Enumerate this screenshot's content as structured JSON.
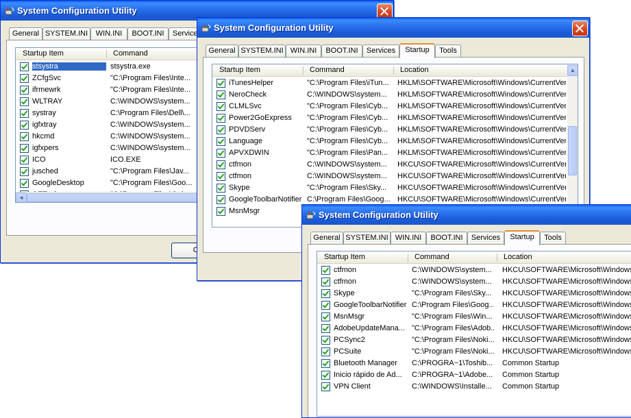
{
  "app_title": "System Configuration Utility",
  "accent": "#e68b2c",
  "tabs": [
    "General",
    "SYSTEM.INI",
    "WIN.INI",
    "BOOT.INI",
    "Services",
    "Startup",
    "Tools"
  ],
  "columns": {
    "item": "Startup Item",
    "command": "Command",
    "location": "Location"
  },
  "win1": {
    "rows": [
      {
        "name": "stsystra",
        "command": "stsystra.exe",
        "selected": true
      },
      {
        "name": "ZCfgSvc",
        "command": "\"C:\\Program Files\\Inte..."
      },
      {
        "name": "ifrmewrk",
        "command": "\"C:\\Program Files\\Inte..."
      },
      {
        "name": "WLTRAY",
        "command": "C:\\WINDOWS\\system..."
      },
      {
        "name": "systray",
        "command": "C:\\Program Files\\Dell\\..."
      },
      {
        "name": "igfxtray",
        "command": "C:\\WINDOWS\\system..."
      },
      {
        "name": "hkcmd",
        "command": "C:\\WINDOWS\\system..."
      },
      {
        "name": "igfxpers",
        "command": "C:\\WINDOWS\\system..."
      },
      {
        "name": "ICO",
        "command": "ICO.EXE"
      },
      {
        "name": "jusched",
        "command": "\"C:\\Program Files\\Jav..."
      },
      {
        "name": "GoogleDesktop",
        "command": "\"C:\\Program Files\\Goo..."
      },
      {
        "name": "QTTask",
        "command": "\"C:\\Program Files\\Quic..."
      }
    ],
    "ok_label": "O"
  },
  "win2": {
    "rows": [
      {
        "name": "iTunesHelper",
        "command": "\"C:\\Program Files\\iTun...",
        "location": "HKLM\\SOFTWARE\\Microsoft\\Windows\\CurrentVer..."
      },
      {
        "name": "NeroCheck",
        "command": "C:\\WINDOWS\\system...",
        "location": "HKLM\\SOFTWARE\\Microsoft\\Windows\\CurrentVer..."
      },
      {
        "name": "CLMLSvc",
        "command": "\"C:\\Program Files\\Cyb...",
        "location": "HKLM\\SOFTWARE\\Microsoft\\Windows\\CurrentVer..."
      },
      {
        "name": "Power2GoExpress",
        "command": "\"C:\\Program Files\\Cyb...",
        "location": "HKLM\\SOFTWARE\\Microsoft\\Windows\\CurrentVer..."
      },
      {
        "name": "PDVDServ",
        "command": "\"C:\\Program Files\\Cyb...",
        "location": "HKLM\\SOFTWARE\\Microsoft\\Windows\\CurrentVer..."
      },
      {
        "name": "Language",
        "command": "\"C:\\Program Files\\Cyb...",
        "location": "HKLM\\SOFTWARE\\Microsoft\\Windows\\CurrentVer..."
      },
      {
        "name": "APVXDWIN",
        "command": "\"C:\\Program Files\\Pan...",
        "location": "HKLM\\SOFTWARE\\Microsoft\\Windows\\CurrentVer..."
      },
      {
        "name": "ctfmon",
        "command": "C:\\WINDOWS\\system...",
        "location": "HKCU\\SOFTWARE\\Microsoft\\Windows\\CurrentVer..."
      },
      {
        "name": "ctfmon",
        "command": "C:\\WINDOWS\\system...",
        "location": "HKCU\\SOFTWARE\\Microsoft\\Windows\\CurrentVer..."
      },
      {
        "name": "Skype",
        "command": "\"C:\\Program Files\\Sky...",
        "location": "HKCU\\SOFTWARE\\Microsoft\\Windows\\CurrentVer..."
      },
      {
        "name": "GoogleToolbarNotifier",
        "command": "C:\\Program Files\\Goog...",
        "location": "HKCU\\SOFTWARE\\Microsoft\\Windows\\CurrentVer..."
      },
      {
        "name": "MsnMsgr",
        "command": "",
        "location": ""
      }
    ]
  },
  "win3": {
    "rows": [
      {
        "name": "ctfmon",
        "command": "C:\\WINDOWS\\system...",
        "location": "HKCU\\SOFTWARE\\Microsoft\\Windows\\C"
      },
      {
        "name": "ctfmon",
        "command": "C:\\WINDOWS\\system...",
        "location": "HKCU\\SOFTWARE\\Microsoft\\Windows\\C"
      },
      {
        "name": "Skype",
        "command": "\"C:\\Program Files\\Sky...",
        "location": "HKCU\\SOFTWARE\\Microsoft\\Windows\\C"
      },
      {
        "name": "GoogleToolbarNotifier",
        "command": "C:\\Program Files\\Goog...",
        "location": "HKCU\\SOFTWARE\\Microsoft\\Windows\\C"
      },
      {
        "name": "MsnMsgr",
        "command": "\"C:\\Program Files\\Win...",
        "location": "HKCU\\SOFTWARE\\Microsoft\\Windows\\C"
      },
      {
        "name": "AdobeUpdateMana...",
        "command": "\"C:\\Program Files\\Adob...",
        "location": "HKCU\\SOFTWARE\\Microsoft\\Windows\\C"
      },
      {
        "name": "PCSync2",
        "command": "\"C:\\Program Files\\Noki...",
        "location": "HKCU\\SOFTWARE\\Microsoft\\Windows\\C"
      },
      {
        "name": "PCSuite",
        "command": "\"C:\\Program Files\\Noki...",
        "location": "HKCU\\SOFTWARE\\Microsoft\\Windows\\C"
      },
      {
        "name": "Bluetooth Manager",
        "command": "C:\\PROGRA~1\\Toshib...",
        "location": "Common Startup"
      },
      {
        "name": "Inicio rápido de Ad...",
        "command": "C:\\PROGRA~1\\Adobe...",
        "location": "Common Startup"
      },
      {
        "name": "VPN Client",
        "command": "C:\\WINDOWS\\Installe...",
        "location": "Common Startup"
      }
    ]
  }
}
